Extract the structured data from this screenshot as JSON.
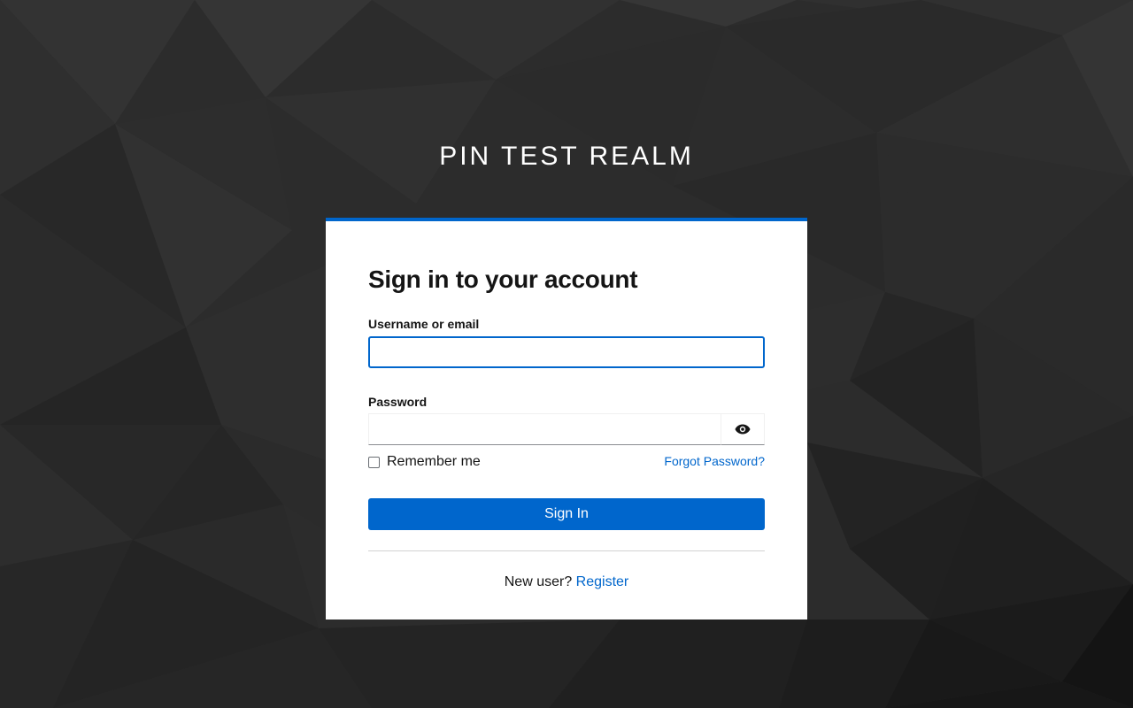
{
  "realm": {
    "title": "PIN TEST REALM"
  },
  "colors": {
    "accent": "#0066cc",
    "background": "#2e2e2e",
    "card": "#ffffff",
    "text": "#151515"
  },
  "login": {
    "heading": "Sign in to your account",
    "username": {
      "label": "Username or email",
      "value": "",
      "placeholder": ""
    },
    "password": {
      "label": "Password",
      "value": "",
      "placeholder": "",
      "toggle_icon": "eye-icon"
    },
    "remember_me": {
      "label": "Remember me",
      "checked": false
    },
    "forgot_password_label": "Forgot Password?",
    "submit_label": "Sign In",
    "new_user_prompt": "New user?",
    "register_label": "Register"
  }
}
